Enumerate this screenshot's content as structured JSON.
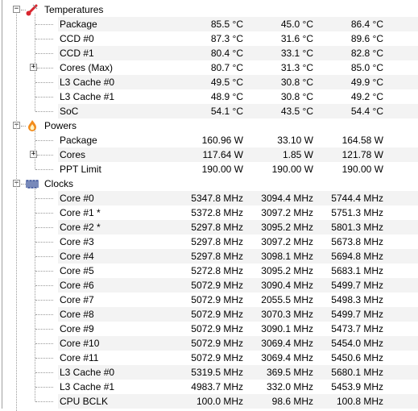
{
  "groups": {
    "temperatures": {
      "label": "Temperatures",
      "rows": [
        {
          "label": "Package",
          "current": "85.5 °C",
          "min": "45.0 °C",
          "max": "86.4 °C"
        },
        {
          "label": "CCD #0",
          "current": "87.3 °C",
          "min": "31.6 °C",
          "max": "89.6 °C"
        },
        {
          "label": "CCD #1",
          "current": "80.4 °C",
          "min": "33.1 °C",
          "max": "82.8 °C"
        },
        {
          "label": "Cores (Max)",
          "current": "80.7 °C",
          "min": "31.3 °C",
          "max": "85.0 °C",
          "expandable": true
        },
        {
          "label": "L3 Cache #0",
          "current": "49.5 °C",
          "min": "30.8 °C",
          "max": "49.9 °C"
        },
        {
          "label": "L3 Cache #1",
          "current": "48.9 °C",
          "min": "30.8 °C",
          "max": "49.2 °C"
        },
        {
          "label": "SoC",
          "current": "54.1 °C",
          "min": "43.5 °C",
          "max": "54.4 °C"
        }
      ]
    },
    "powers": {
      "label": "Powers",
      "rows": [
        {
          "label": "Package",
          "current": "160.96 W",
          "min": "33.10 W",
          "max": "164.58 W"
        },
        {
          "label": "Cores",
          "current": "117.64 W",
          "min": "1.85 W",
          "max": "121.78 W",
          "expandable": true
        },
        {
          "label": "PPT Limit",
          "current": "190.00 W",
          "min": "190.00 W",
          "max": "190.00 W"
        }
      ]
    },
    "clocks": {
      "label": "Clocks",
      "rows": [
        {
          "label": "Core #0",
          "current": "5347.8 MHz",
          "min": "3094.4 MHz",
          "max": "5744.4 MHz"
        },
        {
          "label": "Core #1 *",
          "current": "5372.8 MHz",
          "min": "3097.2 MHz",
          "max": "5751.3 MHz"
        },
        {
          "label": "Core #2 *",
          "current": "5297.8 MHz",
          "min": "3095.2 MHz",
          "max": "5801.3 MHz"
        },
        {
          "label": "Core #3",
          "current": "5297.8 MHz",
          "min": "3097.2 MHz",
          "max": "5673.8 MHz"
        },
        {
          "label": "Core #4",
          "current": "5297.8 MHz",
          "min": "3098.1 MHz",
          "max": "5694.8 MHz"
        },
        {
          "label": "Core #5",
          "current": "5272.8 MHz",
          "min": "3095.2 MHz",
          "max": "5683.1 MHz"
        },
        {
          "label": "Core #6",
          "current": "5072.9 MHz",
          "min": "3090.4 MHz",
          "max": "5499.7 MHz"
        },
        {
          "label": "Core #7",
          "current": "5072.9 MHz",
          "min": "2055.5 MHz",
          "max": "5498.3 MHz"
        },
        {
          "label": "Core #8",
          "current": "5072.9 MHz",
          "min": "3070.3 MHz",
          "max": "5499.7 MHz"
        },
        {
          "label": "Core #9",
          "current": "5072.9 MHz",
          "min": "3090.1 MHz",
          "max": "5473.7 MHz"
        },
        {
          "label": "Core #10",
          "current": "5072.9 MHz",
          "min": "3069.4 MHz",
          "max": "5454.0 MHz"
        },
        {
          "label": "Core #11",
          "current": "5072.9 MHz",
          "min": "3069.4 MHz",
          "max": "5450.6 MHz"
        },
        {
          "label": "L3 Cache #0",
          "current": "5319.5 MHz",
          "min": "369.5 MHz",
          "max": "5680.1 MHz"
        },
        {
          "label": "L3 Cache #1",
          "current": "4983.7 MHz",
          "min": "332.0 MHz",
          "max": "5453.9 MHz"
        },
        {
          "label": "CPU BCLK",
          "current": "100.0 MHz",
          "min": "98.6 MHz",
          "max": "100.8 MHz"
        }
      ]
    }
  },
  "icons": {
    "temperatures": "thermometer-icon",
    "powers": "flame-icon",
    "clocks": "clock-wave-icon"
  },
  "colors": {
    "row_stripe": "#f3f3f3",
    "tree_lines": "#9a9a9a",
    "thermometer_red": "#d9262f",
    "flame_orange": "#f28c1c",
    "clock_blue": "#1f3b8c"
  }
}
